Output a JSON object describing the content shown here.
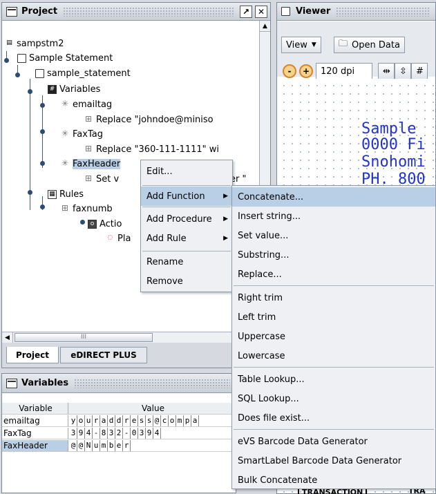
{
  "project_panel": {
    "title": "Project",
    "tree": {
      "root": "sampstm2",
      "statement": "Sample Statement",
      "sample": "sample_statement",
      "variables": "Variables",
      "emailtag": "emailtag",
      "emailtag_action": "Replace \"johndoe@miniso",
      "faxtag": "FaxTag",
      "faxtag_action": "Replace \"360-111-1111\" wi",
      "faxheader": "FaxHeader",
      "faxheader_action_a": "Set v",
      "faxheader_action_b": "er \"",
      "rules": "Rules",
      "faxnumb": "faxnumb",
      "actio": "Actio",
      "pla": "Pla"
    },
    "scroll_mid": "III",
    "tabs": [
      "Project",
      "eDIRECT PLUS"
    ]
  },
  "viewer_panel": {
    "title": "Viewer",
    "view_label": "View",
    "open_data_label": "Open Data",
    "dpi": "120 dpi",
    "preview_lines": [
      "Sample",
      "0000 Fi",
      "Snohomi",
      "PH. 800"
    ],
    "bottom_labels": [
      "TRANSACTION",
      "TRA"
    ]
  },
  "variables_panel": {
    "title": "Variables",
    "headers": [
      "Variable",
      "Value"
    ],
    "rows": [
      {
        "name": "emailtag",
        "chars": [
          "y",
          "o",
          "u",
          "r",
          "a",
          "d",
          "d",
          "r",
          "e",
          "s",
          "s",
          "@",
          "c",
          "o",
          "m",
          "p",
          "a"
        ]
      },
      {
        "name": "FaxTag",
        "chars": [
          "3",
          "9",
          "4",
          "-",
          "8",
          "3",
          "2",
          "-",
          "0",
          "3",
          "9",
          "4"
        ]
      },
      {
        "name": "FaxHeader",
        "chars": [
          "@",
          "@",
          "N",
          "u",
          "m",
          "b",
          "e",
          "r"
        ]
      }
    ]
  },
  "context_menu": {
    "items": [
      {
        "label": "Edit..."
      },
      {
        "label": "Add Function",
        "submenu": true
      },
      {
        "label": "Add Procedure",
        "submenu": true
      },
      {
        "label": "Add Rule",
        "submenu": true
      },
      {
        "label": "Rename"
      },
      {
        "label": "Remove"
      }
    ]
  },
  "function_submenu": {
    "groups": [
      [
        "Concatenate...",
        "Insert string...",
        "Set value...",
        "Substring...",
        "Replace..."
      ],
      [
        "Right trim",
        "Left trim",
        "Uppercase",
        "Lowercase"
      ],
      [
        "Table Lookup...",
        "SQL Lookup...",
        "Does file exist..."
      ],
      [
        "eVS Barcode Data Generator",
        "SmartLabel Barcode Data Generator",
        "Bulk Concatenate"
      ]
    ]
  },
  "colors": {
    "selection": "#b8cfe5",
    "preview_text": "#2233cc"
  }
}
